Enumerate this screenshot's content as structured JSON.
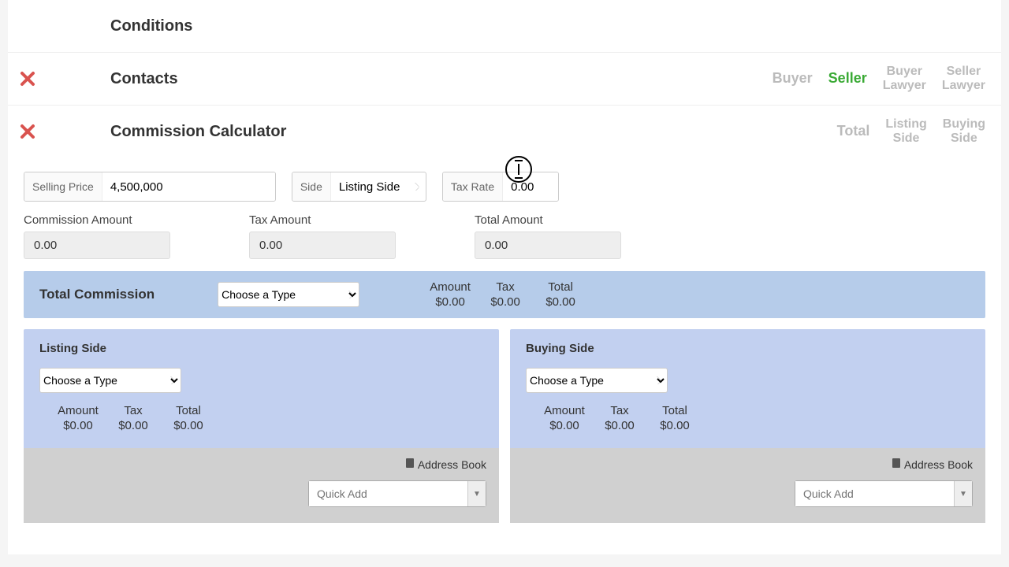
{
  "sections": {
    "conditions": {
      "title": "Conditions"
    },
    "contacts": {
      "title": "Contacts",
      "tabs": [
        "Buyer",
        "Seller",
        "Buyer\nLawyer",
        "Seller\nLawyer"
      ],
      "active": "Seller"
    },
    "calculator": {
      "title": "Commission Calculator",
      "tabs": [
        "Total",
        "Listing\nSide",
        "Buying\nSide"
      ]
    }
  },
  "form": {
    "selling_price_label": "Selling Price",
    "selling_price_value": "4,500,000",
    "side_label": "Side",
    "side_value": "Listing Side",
    "tax_rate_label": "Tax Rate",
    "tax_rate_value": "0.00"
  },
  "amounts": {
    "commission_label": "Commission Amount",
    "commission_value": "0.00",
    "tax_label": "Tax Amount",
    "tax_value": "0.00",
    "total_label": "Total Amount",
    "total_value": "0.00"
  },
  "total_commission": {
    "title": "Total Commission",
    "choose_option": "Choose a Type",
    "headers": [
      "Amount",
      "Tax",
      "Total"
    ],
    "values": [
      "$0.00",
      "$0.00",
      "$0.00"
    ]
  },
  "side_panel": {
    "listing_title": "Listing Side",
    "buying_title": "Buying Side",
    "choose_option": "Choose a Type",
    "headers": [
      "Amount",
      "Tax",
      "Total"
    ],
    "values": [
      "$0.00",
      "$0.00",
      "$0.00"
    ],
    "address_book": "Address Book",
    "quick_add_placeholder": "Quick Add"
  }
}
